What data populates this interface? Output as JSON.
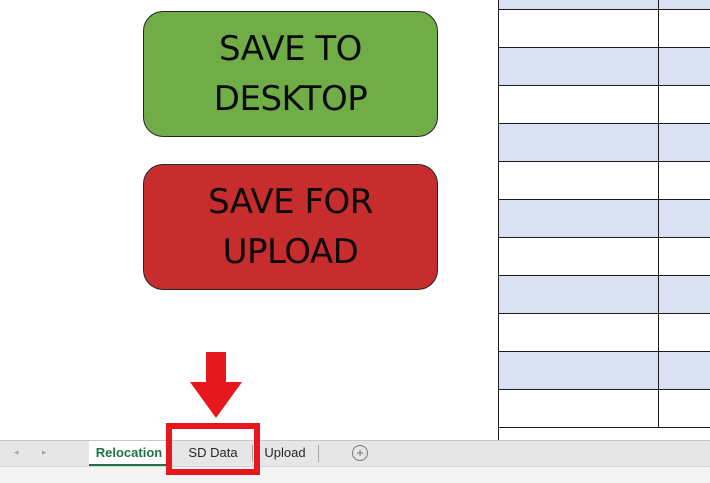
{
  "buttons": {
    "save_desktop": {
      "label": "SAVE TO\nDESKTOP",
      "color": "#70ad47"
    },
    "save_upload": {
      "label": "SAVE FOR\nUPLOAD",
      "color": "#c82d2d"
    }
  },
  "grid": {
    "band_color": "#d9e1f2",
    "rows": [
      "band",
      "plain",
      "band",
      "plain",
      "band",
      "plain",
      "band",
      "plain",
      "band",
      "plain",
      "band",
      "plain"
    ]
  },
  "sheet_tabs": {
    "tabs": [
      {
        "label": "Relocation",
        "active": true
      },
      {
        "label": "SD Data",
        "active": false
      },
      {
        "label": "Upload",
        "active": false
      }
    ],
    "add_icon": "+",
    "nav_prev_icon": "◂",
    "nav_next_icon": "▸"
  },
  "annotation": {
    "arrow_color": "#e8171e",
    "highlight_target": "SD Data"
  },
  "accent_color": "#217346"
}
